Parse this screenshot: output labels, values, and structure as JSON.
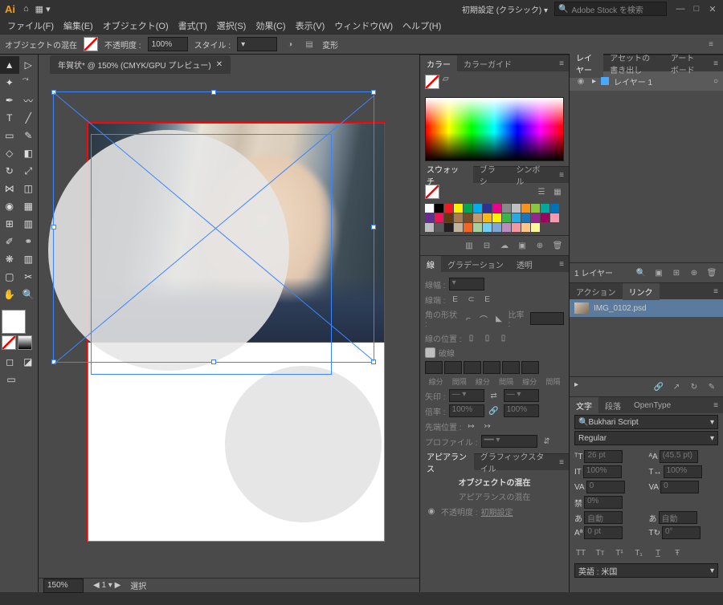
{
  "title_bar": {
    "app": "Ai",
    "workspace": "初期設定 (クラシック)",
    "search_placeholder": "Adobe Stock を検索"
  },
  "menu": [
    "ファイル(F)",
    "編集(E)",
    "オブジェクト(O)",
    "書式(T)",
    "選択(S)",
    "効果(C)",
    "表示(V)",
    "ウィンドウ(W)",
    "ヘルプ(H)"
  ],
  "options_bar": {
    "target_label": "オブジェクトの混在",
    "opacity_label": "不透明度 :",
    "opacity_value": "100%",
    "style_label": "スタイル :",
    "transform_label": "変形"
  },
  "document": {
    "tab_title": "年賀状* @ 150% (CMYK/GPU プレビュー)",
    "artboard_name": "年賀状"
  },
  "statusbar": {
    "zoom": "150%",
    "tool_status": "選択"
  },
  "mid_panels": {
    "color": {
      "tabs": [
        "カラー",
        "カラーガイド"
      ]
    },
    "swatches": {
      "tabs": [
        "スウォッチ",
        "ブラシ",
        "シンボル"
      ]
    },
    "stroke": {
      "tabs": [
        "線",
        "グラデーション",
        "透明"
      ],
      "weight_label": "線幅 :",
      "cap_label": "線端 :",
      "corner_label": "角の形状 :",
      "limit_label": "比率 :",
      "align_label": "線の位置 :",
      "dash_label": "破線",
      "dash_h1": "線分",
      "dash_h2": "間隔",
      "arrow_label": "矢印 :",
      "scale_label": "倍率 :",
      "scale_v1": "100%",
      "scale_v2": "100%",
      "arrow_align_label": "先端位置 :",
      "profile_label": "プロファイル :"
    },
    "appearance": {
      "tabs": [
        "アピアランス",
        "グラフィックスタイル"
      ],
      "title": "オブジェクトの混在",
      "sub": "アピアランスの混在",
      "opacity_label": "不透明度 :",
      "opacity_value": "初期設定"
    }
  },
  "right_panels": {
    "layers": {
      "tabs": [
        "レイヤー",
        "アセットの書き出し",
        "アートボード"
      ],
      "layer1": "レイヤー 1",
      "footer": "1 レイヤー"
    },
    "links": {
      "tabs": [
        "アクション",
        "リンク"
      ],
      "file": "IMG_0102.psd"
    },
    "character": {
      "tabs": [
        "文字",
        "段落",
        "OpenType"
      ],
      "font": "Bukhari Script",
      "style": "Regular",
      "size": "26 pt",
      "leading": "(45.5 pt)",
      "vscale": "100%",
      "hscale": "100%",
      "kerning": "0",
      "tracking": "0",
      "baseline_pct": "0%",
      "aki_auto1": "自動",
      "aki_auto2": "自動",
      "baseline_shift": "0 pt",
      "rotation": "0°",
      "language_label": "英語 : 米国"
    }
  },
  "swatch_colors": [
    "#ffffff",
    "#000000",
    "#ed1c24",
    "#fff200",
    "#00a651",
    "#00aeef",
    "#2e3192",
    "#ec008c",
    "#898989",
    "#c0c0c0",
    "#f7941d",
    "#8dc63e",
    "#00a99d",
    "#0072bc",
    "#662d91",
    "#ed145b",
    "#603913",
    "#a67c52",
    "#754c24",
    "#c49a6c",
    "#fdb913",
    "#fef200",
    "#39b54a",
    "#27aae1",
    "#1b75bb",
    "#92278f",
    "#9e005d",
    "#f59ab0",
    "#bcbec0",
    "#58595b",
    "#231f20",
    "#c2b59b",
    "#f26522",
    "#a3d39c",
    "#6dcff6",
    "#7da7d9",
    "#bd8cbf",
    "#f5989d",
    "#fdc689",
    "#fff799"
  ]
}
